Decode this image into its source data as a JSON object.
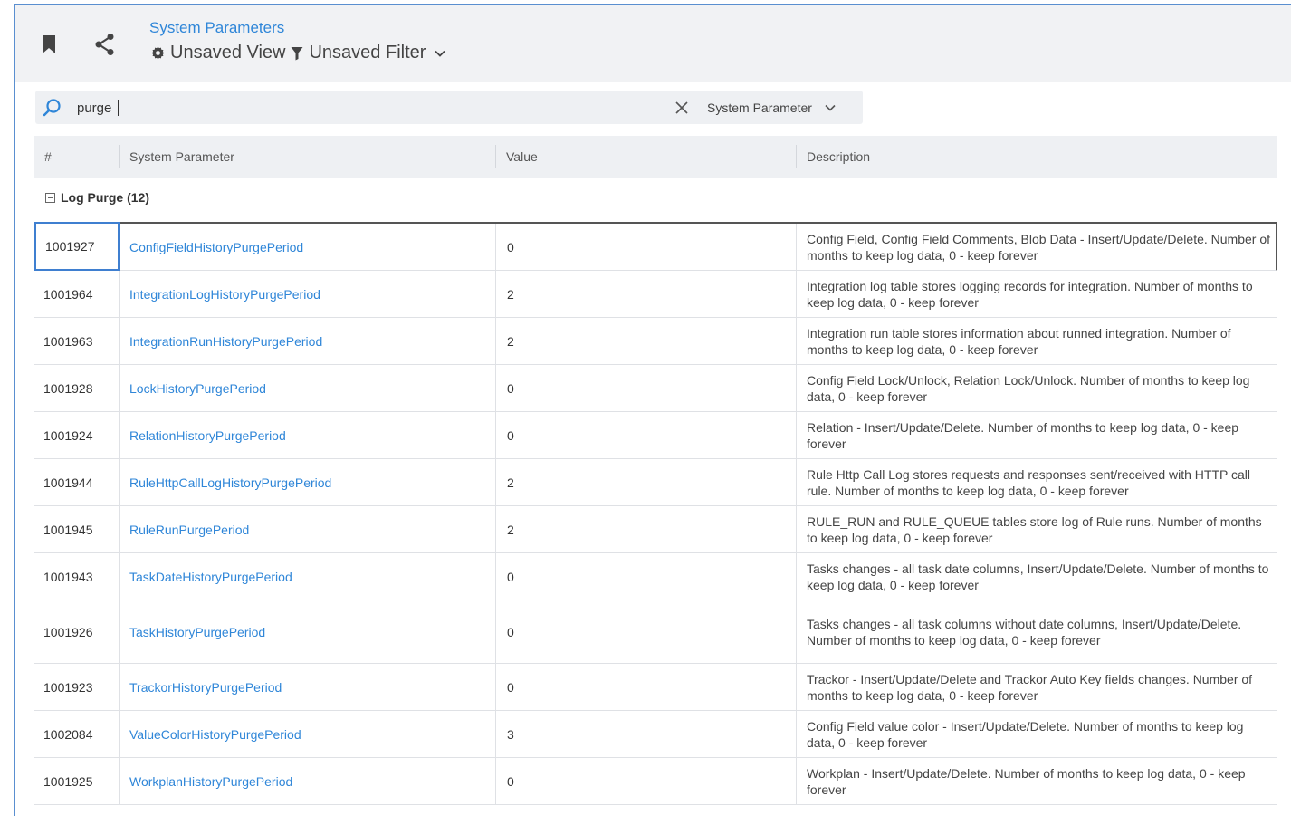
{
  "header": {
    "title": "System Parameters",
    "view_label": "Unsaved View",
    "filter_label": "Unsaved Filter"
  },
  "search": {
    "value": "purge",
    "field_label": "System Parameter"
  },
  "columns": [
    "#",
    "System Parameter",
    "Value",
    "Description"
  ],
  "group": {
    "label": "Log Purge (12)"
  },
  "rows": [
    {
      "id": "1001927",
      "name": "ConfigFieldHistoryPurgePeriod",
      "value": "0",
      "desc": "Config Field, Config Field Comments, Blob Data - Insert/Update/Delete. Number of months to keep log data, 0 - keep forever"
    },
    {
      "id": "1001964",
      "name": "IntegrationLogHistoryPurgePeriod",
      "value": "2",
      "desc": "Integration log table stores logging records for integration. Number of months to keep log data, 0 - keep forever"
    },
    {
      "id": "1001963",
      "name": "IntegrationRunHistoryPurgePeriod",
      "value": "2",
      "desc": "Integration run table stores information about runned integration. Number of months to keep log data, 0 - keep forever"
    },
    {
      "id": "1001928",
      "name": "LockHistoryPurgePeriod",
      "value": "0",
      "desc": "Config Field Lock/Unlock, Relation Lock/Unlock. Number of months to keep log data, 0 - keep forever"
    },
    {
      "id": "1001924",
      "name": "RelationHistoryPurgePeriod",
      "value": "0",
      "desc": "Relation - Insert/Update/Delete. Number of months to keep log data, 0 - keep forever"
    },
    {
      "id": "1001944",
      "name": "RuleHttpCallLogHistoryPurgePeriod",
      "value": "2",
      "desc": "Rule Http Call Log stores requests and responses sent/received with HTTP call rule. Number of months to keep log data, 0 - keep forever"
    },
    {
      "id": "1001945",
      "name": "RuleRunPurgePeriod",
      "value": "2",
      "desc": "RULE_RUN and RULE_QUEUE tables store log of Rule runs. Number of months to keep log data, 0 - keep forever"
    },
    {
      "id": "1001943",
      "name": "TaskDateHistoryPurgePeriod",
      "value": "0",
      "desc": "Tasks changes - all task date columns, Insert/Update/Delete. Number of months to keep log data, 0 - keep forever"
    },
    {
      "id": "1001926",
      "name": "TaskHistoryPurgePeriod",
      "value": "0",
      "desc": "Tasks changes - all task columns without date columns, Insert/Update/Delete. Number of months to keep log data, 0 - keep forever"
    },
    {
      "id": "1001923",
      "name": "TrackorHistoryPurgePeriod",
      "value": "0",
      "desc": "Trackor - Insert/Update/Delete and Trackor Auto Key fields changes. Number of months to keep log data, 0 - keep forever"
    },
    {
      "id": "1002084",
      "name": "ValueColorHistoryPurgePeriod",
      "value": "3",
      "desc": "Config Field value color - Insert/Update/Delete. Number of months to keep log data, 0 - keep forever"
    },
    {
      "id": "1001925",
      "name": "WorkplanHistoryPurgePeriod",
      "value": "0",
      "desc": "Workplan - Insert/Update/Delete. Number of months to keep log data, 0 - keep forever"
    }
  ],
  "colors": {
    "accent": "#2f86d8",
    "header_bg": "#f1f2f4",
    "table_header_bg": "#eef0f3"
  },
  "icons": [
    "bookmark-icon",
    "share-icon",
    "gear-icon",
    "filter-icon",
    "chevron-down-icon",
    "search-icon",
    "close-icon",
    "collapse-icon"
  ]
}
